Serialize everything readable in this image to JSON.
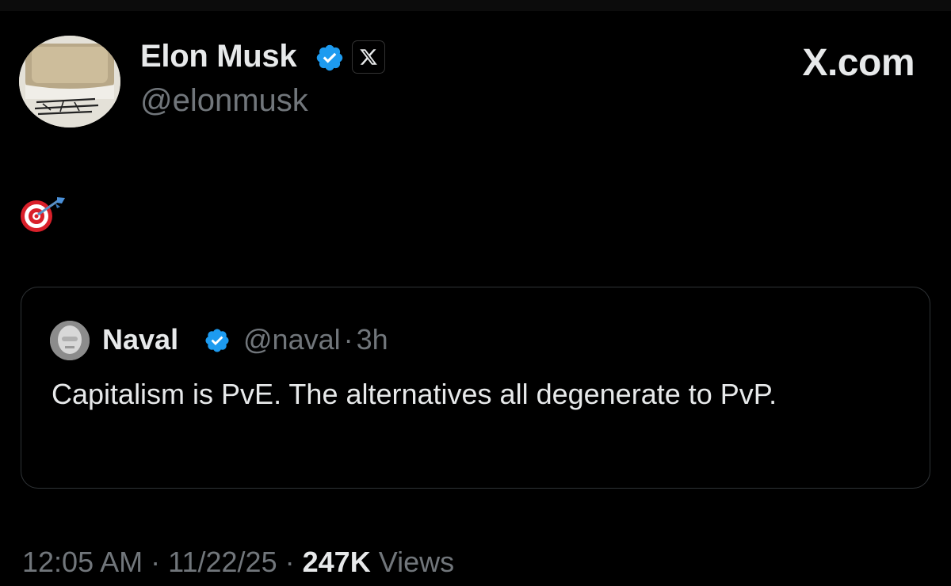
{
  "author": {
    "name": "Elon Musk",
    "handle": "@elonmusk",
    "avatar_icon": "avatar-image",
    "verified_icon": "verified-badge-icon",
    "affiliate_icon": "x-logo-icon"
  },
  "brand": {
    "label": "X.com"
  },
  "tweet": {
    "text_emoji": "🎯",
    "emoji_name": "direct-hit-icon"
  },
  "quote": {
    "name": "Naval",
    "handle": "@naval",
    "separator": "·",
    "time": "3h",
    "text": "Capitalism is PvE. The alternatives all degenerate to PvP."
  },
  "footer": {
    "time": "12:05 AM",
    "separator": "·",
    "date": "11/22/25",
    "views_count": "247K",
    "views_label": "Views"
  },
  "colors": {
    "background": "#000000",
    "primary_text": "#e7e9ea",
    "secondary_text": "#71767b",
    "verified_blue": "#1d9bf0",
    "border": "#2f3336"
  }
}
